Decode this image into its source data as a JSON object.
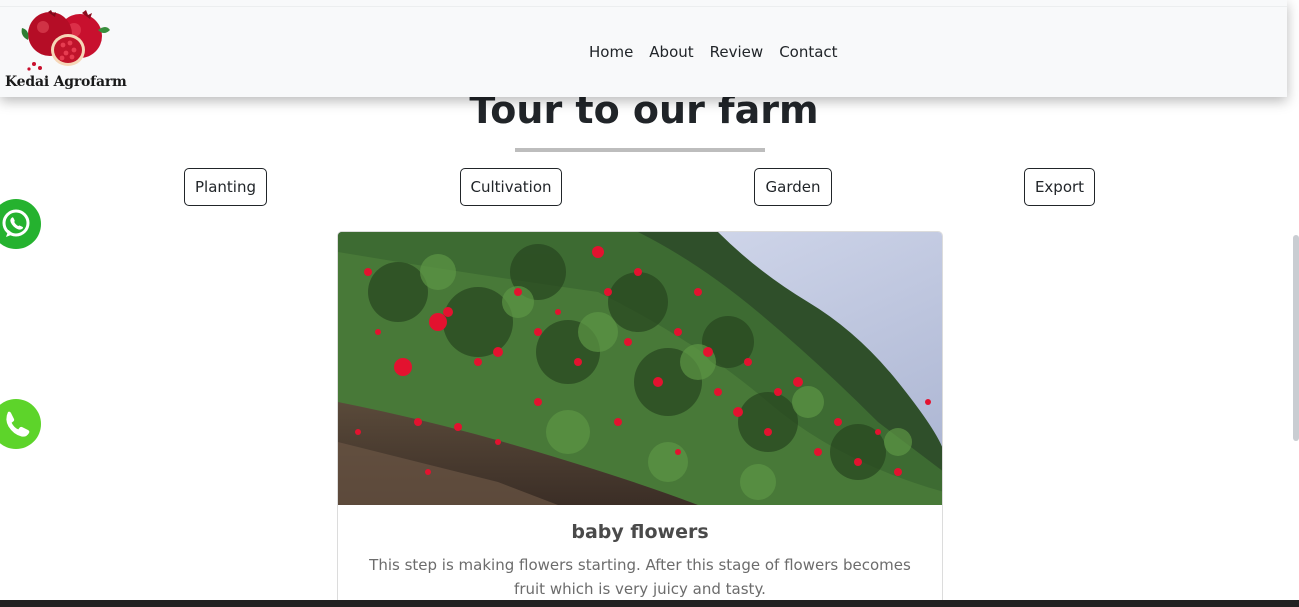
{
  "navbar": {
    "brand_name": "Kedai Agrofarm",
    "links": [
      "Home",
      "About",
      "Review",
      "Contact"
    ]
  },
  "section": {
    "title": "Tour to our farm"
  },
  "filters": [
    "Planting",
    "Cultivation",
    "Garden",
    "Export"
  ],
  "floating": {
    "whatsapp_icon": "whatsapp-icon",
    "phone_icon": "phone-icon"
  },
  "card": {
    "image": "pomegranate-flowers-photo",
    "title": "baby flowers",
    "text": "This step is making flowers starting. After this stage of flowers becomes fruit which is very juicy and tasty."
  },
  "colors": {
    "navbar_bg": "#f8f9fa",
    "whatsapp_green": "#25b22f",
    "phone_green": "#5dd42a",
    "text_dark": "#212529"
  }
}
